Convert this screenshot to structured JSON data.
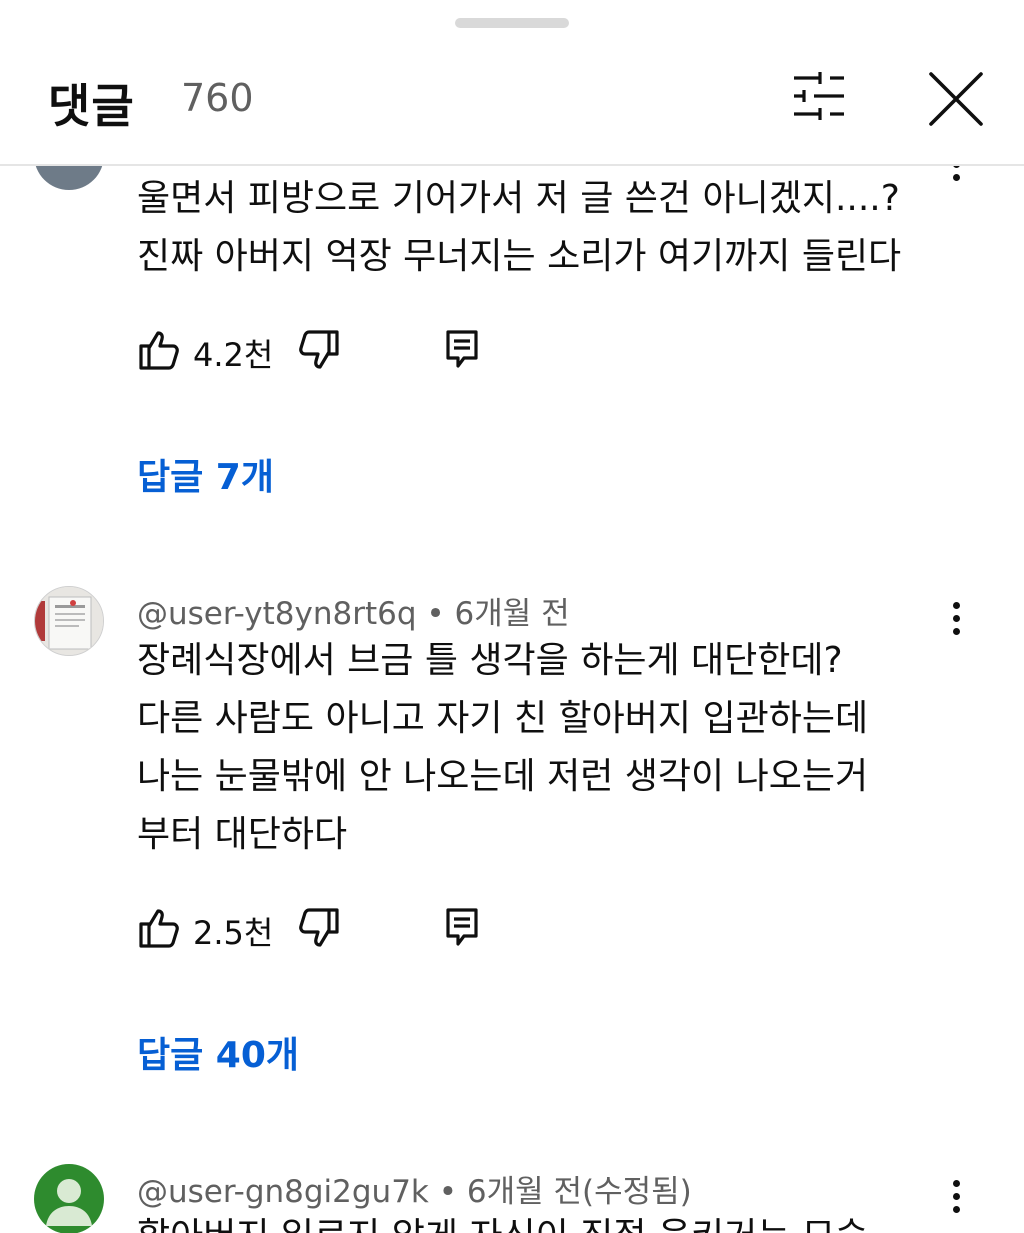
{
  "header": {
    "title": "댓글",
    "count": "760"
  },
  "comments": [
    {
      "author": "",
      "lines": [
        "울면서 피방으로 기어가서 저 글 쓴건 아니겠지....?",
        "진짜 아버지 억장 무너지는 소리가 여기까지 들린다"
      ],
      "likes": "4.2천",
      "replies": "답글 7개"
    },
    {
      "author": "@user-yt8yn8rt6q • 6개월 전",
      "lines": [
        "장례식장에서 브금 틀 생각을 하는게 대단한데?",
        "다른 사람도 아니고 자기 친 할아버지 입관하는데",
        "나는 눈물밖에 안 나오는데 저런 생각이 나오는거",
        "부터 대단하다"
      ],
      "likes": "2.5천",
      "replies": "답글 40개"
    },
    {
      "author": "@user-gn8gi2gu7k • 6개월 전(수정됨)",
      "lines": [
        "할아버지 일르지 않게 자신이 직접 움키거는 모습"
      ],
      "likes": "",
      "replies": ""
    }
  ],
  "colors": {
    "link": "#065fd4",
    "secondary_text": "#606060",
    "primary_text": "#0f0f0f"
  },
  "icons": [
    "filter-icon",
    "close-icon",
    "thumbs-up-icon",
    "thumbs-down-icon",
    "reply-icon",
    "more-vert-icon",
    "default-avatar-icon"
  ]
}
